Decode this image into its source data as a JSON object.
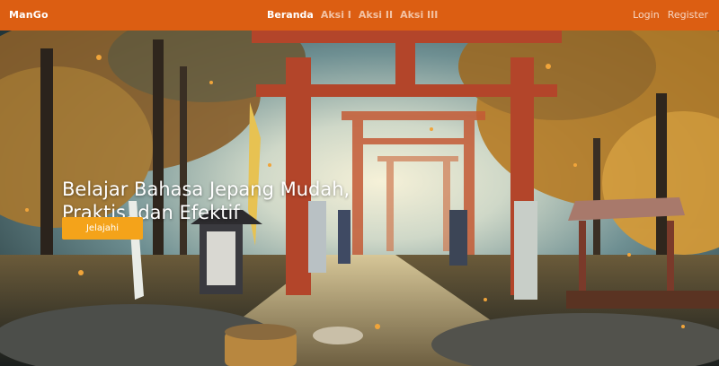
{
  "brand": "ManGo",
  "nav": {
    "items": [
      {
        "label": "Beranda",
        "active": true
      },
      {
        "label": "Aksi I",
        "active": false
      },
      {
        "label": "Aksi II",
        "active": false
      },
      {
        "label": "Aksi III",
        "active": false
      }
    ]
  },
  "auth": {
    "login": "Login",
    "register": "Register"
  },
  "hero": {
    "title": "Belajar Bahasa Jepang Mudah, Praktis, dan Efektif",
    "cta_label": "Jelajahi"
  },
  "colors": {
    "navbar": "#dc5e12",
    "cta": "#f4a31a"
  }
}
